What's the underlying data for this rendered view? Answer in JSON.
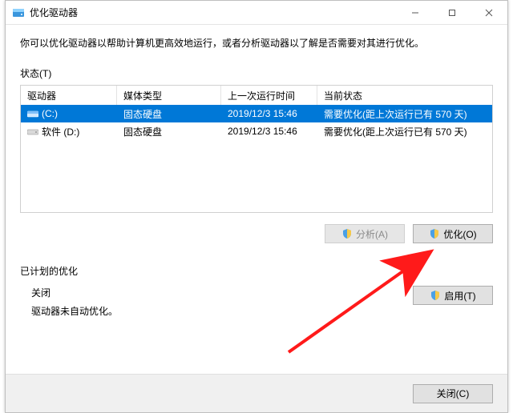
{
  "window": {
    "title": "优化驱动器"
  },
  "intro": "你可以优化驱动器以帮助计算机更高效地运行，或者分析驱动器以了解是否需要对其进行优化。",
  "status_label": "状态(T)",
  "columns": {
    "drive": "驱动器",
    "media": "媒体类型",
    "last_run": "上一次运行时间",
    "current": "当前状态"
  },
  "rows": [
    {
      "name": "(C:)",
      "media": "固态硬盘",
      "last_run": "2019/12/3 15:46",
      "status": "需要优化(距上次运行已有 570 天)",
      "selected": true
    },
    {
      "name": "软件 (D:)",
      "media": "固态硬盘",
      "last_run": "2019/12/3 15:46",
      "status": "需要优化(距上次运行已有 570 天)",
      "selected": false
    }
  ],
  "buttons": {
    "analyze": "分析(A)",
    "optimize": "优化(O)",
    "enable": "启用(T)",
    "close": "关闭(C)"
  },
  "scheduled": {
    "title": "已计划的优化",
    "state": "关闭",
    "desc": "驱动器未自动优化。"
  },
  "colors": {
    "selection": "#0078d7",
    "arrow": "#ff1a1a"
  }
}
